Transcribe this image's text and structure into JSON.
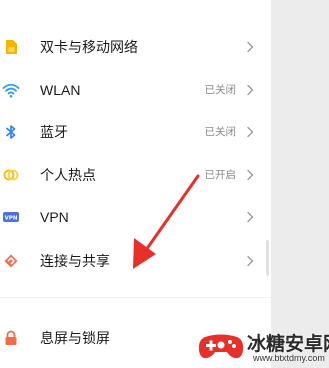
{
  "settings": {
    "items": [
      {
        "label": "双卡与移动网络",
        "status": "",
        "icon": "sim-card-icon",
        "color": "#f5b400"
      },
      {
        "label": "WLAN",
        "status": "已关闭",
        "icon": "wifi-icon",
        "color": "#2f9bf0"
      },
      {
        "label": "蓝牙",
        "status": "已关闭",
        "icon": "bluetooth-icon",
        "color": "#2f86f0"
      },
      {
        "label": "个人热点",
        "status": "已开启",
        "icon": "hotspot-icon",
        "color": "#f3c21a"
      },
      {
        "label": "VPN",
        "status": "",
        "icon": "vpn-icon",
        "color": "#4a73d9"
      },
      {
        "label": "连接与共享",
        "status": "",
        "icon": "connection-share-icon",
        "color": "#f36b4b"
      },
      {
        "label": "息屏与锁屏",
        "status": "",
        "icon": "lock-screen-icon",
        "color": "#f36b4b"
      }
    ],
    "vpn_badge": "VPN"
  },
  "annotation": {
    "arrow_color": "#e8302a",
    "icon": "red-arrow-annotation"
  },
  "watermark": {
    "title": "冰糖安卓网",
    "url": "www.btxtdmy.com",
    "icon": "gamepad-logo-icon"
  }
}
